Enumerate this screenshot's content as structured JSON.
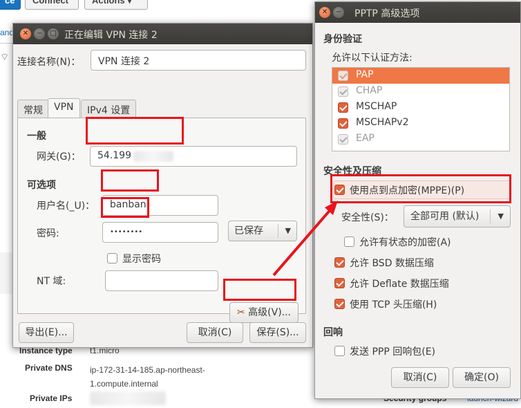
{
  "background": {
    "buttons": [
      "ce",
      "Connect",
      "Actions"
    ],
    "side_text": "and",
    "fields": [
      {
        "label": "Instance type",
        "value": "t1.micro"
      },
      {
        "label": "Private DNS",
        "value": "ip-172-31-14-185.ap-northeast-1.compute.internal"
      },
      {
        "label": "Private IPs",
        "value": ""
      }
    ],
    "security_groups_label": "Security groups",
    "security_groups_link": "launch-wizard"
  },
  "vpn_dialog": {
    "title": "正在编辑 VPN 连接 2",
    "conn_name_label": "连接名称(N)：",
    "conn_name_value": "VPN 连接 2",
    "tabs": [
      "常规",
      "VPN",
      "IPv4 设置"
    ],
    "active_tab": "VPN",
    "section_general": "一般",
    "gateway_label": "网关(G)：",
    "gateway_value": "54.199",
    "section_optional": "可选项",
    "username_label": "用户名(_U)：",
    "username_value": "banban",
    "password_label": "密码:",
    "password_value": "••••••••",
    "password_mode": "已保存",
    "show_password": "显示密码",
    "nt_domain_label": "NT 域:",
    "nt_domain_value": "",
    "advanced_button": "高级(V)...",
    "export_button": "导出(E)...",
    "cancel_button": "取消(C)",
    "save_button": "保存(S)..."
  },
  "pptp_dialog": {
    "title": "PPTP 高级选项",
    "section_auth": "身份验证",
    "auth_hint": "允许以下认证方法:",
    "auth_methods": [
      {
        "name": "PAP",
        "checked": true,
        "enabled": true,
        "selected": true
      },
      {
        "name": "CHAP",
        "checked": true,
        "enabled": false
      },
      {
        "name": "MSCHAP",
        "checked": true,
        "enabled": true
      },
      {
        "name": "MSCHAPv2",
        "checked": true,
        "enabled": true
      },
      {
        "name": "EAP",
        "checked": true,
        "enabled": false
      }
    ],
    "section_security": "安全性及压缩",
    "use_mppe": "使用点到点加密(MPPE)(P)",
    "security_label": "安全性(S)：",
    "security_value": "全部可用 (默认)",
    "stateful_encryption": "允许有状态的加密(A)",
    "bsd_compression": "允许 BSD 数据压缩",
    "deflate_compression": "允许 Deflate 数据压缩",
    "tcp_header_compression": "使用 TCP 头压缩(H)",
    "section_echo": "回响",
    "send_ppp_echo": "发送 PPP 回响包(E)",
    "cancel_button": "取消(C)",
    "ok_button": "确定(O)"
  },
  "colors": {
    "accent": "#e2623a",
    "highlight_box": "#e8141c",
    "titlebar": "#3c3b37",
    "selection": "#f07746"
  }
}
